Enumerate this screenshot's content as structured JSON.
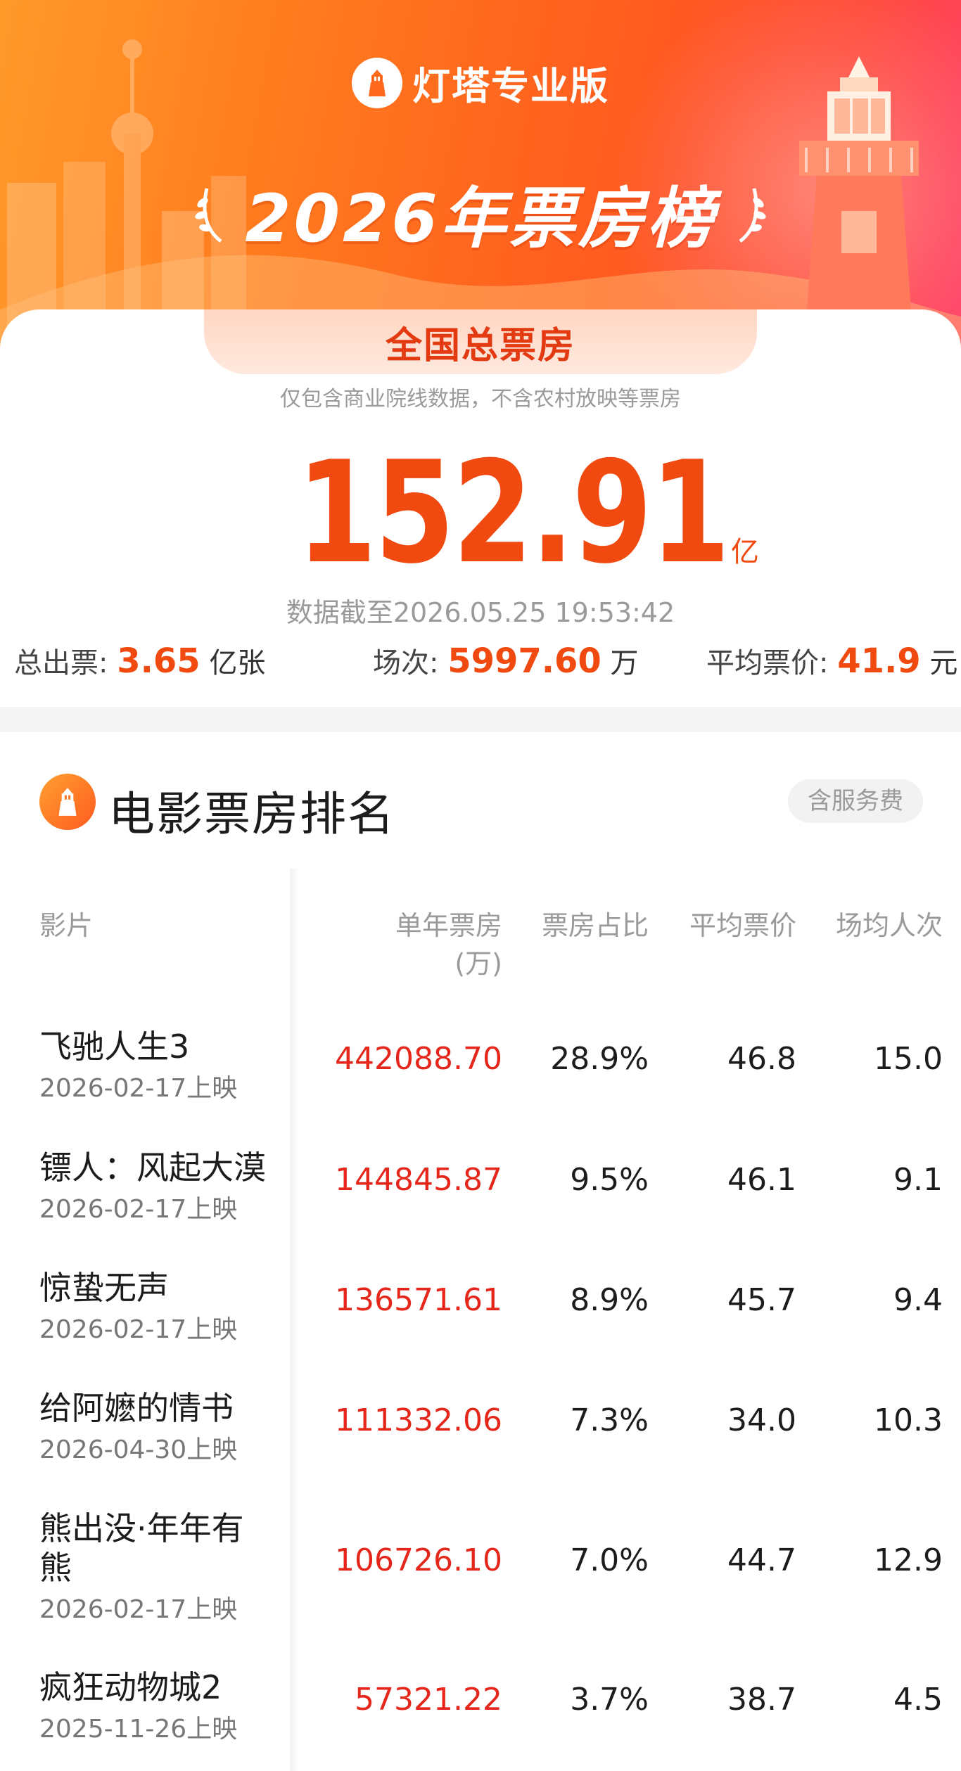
{
  "header": {
    "brand_name": "灯塔专业版",
    "title": "2026年票房榜"
  },
  "summary": {
    "pill_label": "全国总票房",
    "note": "仅包含商业院线数据，不含农村放映等票房",
    "total_value": "152.91",
    "total_unit": "亿",
    "updated": "数据截至2026.05.25 19:53:42",
    "stats": {
      "tickets_label": "总出票:",
      "tickets_value": "3.65",
      "tickets_unit": "亿张",
      "shows_label": "场次:",
      "shows_value": "5997.60",
      "shows_unit": "万",
      "avg_price_label": "平均票价:",
      "avg_price_value": "41.9",
      "avg_price_unit": "元"
    }
  },
  "ranking": {
    "title": "电影票房排名",
    "fee_badge": "含服务费",
    "columns": {
      "film": "影片",
      "box_office": "单年票房",
      "box_office_unit": "(万)",
      "share": "票房占比",
      "avg_price": "平均票价",
      "avg_people": "场均人次"
    },
    "rows": [
      {
        "film": "飞驰人生3",
        "date": "2026-02-17上映",
        "box_office": "442088.70",
        "share": "28.9%",
        "avg_price": "46.8",
        "avg_people": "15.0"
      },
      {
        "film": "镖人：风起大漠",
        "date": "2026-02-17上映",
        "box_office": "144845.87",
        "share": "9.5%",
        "avg_price": "46.1",
        "avg_people": "9.1"
      },
      {
        "film": "惊蛰无声",
        "date": "2026-02-17上映",
        "box_office": "136571.61",
        "share": "8.9%",
        "avg_price": "45.7",
        "avg_people": "9.4"
      },
      {
        "film": "给阿嬷的情书",
        "date": "2026-04-30上映",
        "box_office": "111332.06",
        "share": "7.3%",
        "avg_price": "34.0",
        "avg_people": "10.3"
      },
      {
        "film": "熊出没·年年有熊",
        "date": "2026-02-17上映",
        "box_office": "106726.10",
        "share": "7.0%",
        "avg_price": "44.7",
        "avg_people": "12.9"
      },
      {
        "film": "疯狂动物城2",
        "date": "2025-11-26上映",
        "box_office": "57321.22",
        "share": "3.7%",
        "avg_price": "38.7",
        "avg_people": "4.5"
      }
    ]
  },
  "colors": {
    "accent": "#f04a10",
    "box_office_red": "#e5261b",
    "header_start": "#ff9a2a",
    "header_end": "#ff3f6a"
  }
}
